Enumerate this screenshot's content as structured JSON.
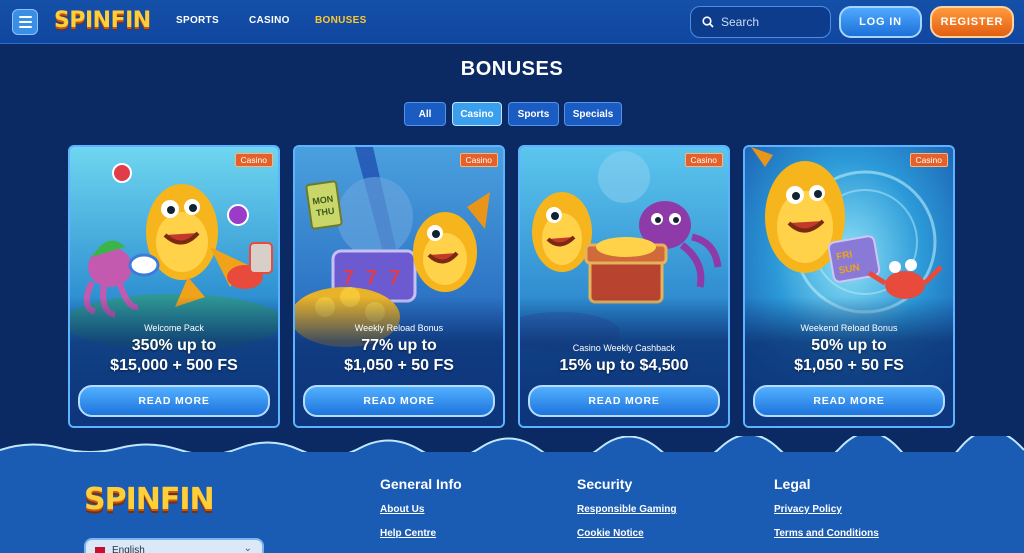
{
  "header": {
    "logo": "SPINFIN",
    "nav": [
      "SPORTS",
      "CASINO",
      "BONUSES"
    ],
    "search_placeholder": "Search",
    "login": "LOG IN",
    "register": "REGISTER"
  },
  "page": {
    "title": "BONUSES",
    "filters": [
      "All",
      "Casino",
      "Sports",
      "Specials"
    ],
    "active_filter": "Casino"
  },
  "cards": [
    {
      "badge": "Casino",
      "subtitle": "Welcome Pack",
      "line1": "350% up to",
      "line2": "$15,000 + 500 FS",
      "button": "READ MORE"
    },
    {
      "badge": "Casino",
      "subtitle": "Weekly Reload Bonus",
      "line1": "77% up to",
      "line2": "$1,050 + 50 FS",
      "button": "READ MORE",
      "sign_text": "MON THU"
    },
    {
      "badge": "Casino",
      "subtitle": "Casino Weekly Cashback",
      "line1": "15% up to $4,500",
      "line2": "",
      "button": "READ MORE"
    },
    {
      "badge": "Casino",
      "subtitle": "Weekend Reload Bonus",
      "line1": "50% up to",
      "line2": "$1,050 + 50 FS",
      "button": "READ MORE",
      "sign_text": "FRI SUN"
    }
  ],
  "footer": {
    "logo": "SPINFIN",
    "language": "English",
    "columns": [
      {
        "title": "General Info",
        "links": [
          "About Us",
          "Help Centre"
        ]
      },
      {
        "title": "Security",
        "links": [
          "Responsible Gaming",
          "Cookie Notice"
        ]
      },
      {
        "title": "Legal",
        "links": [
          "Privacy Policy",
          "Terms and Conditions"
        ]
      }
    ]
  },
  "colors": {
    "background": "#0b2a63",
    "header": "#1550a8",
    "accent_yellow": "#ffc82e",
    "register_orange": "#e25f12",
    "button_blue": "#1d74dd",
    "badge_orange": "#e4622a"
  }
}
